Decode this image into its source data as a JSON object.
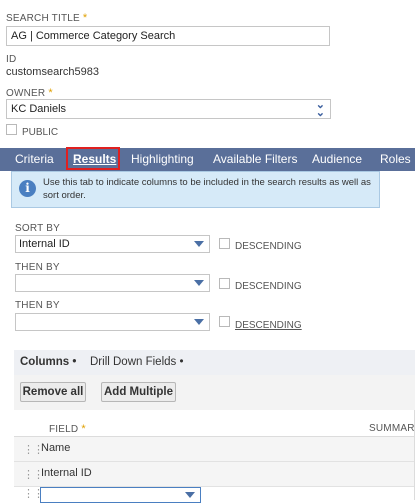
{
  "form": {
    "search_title_label": "SEARCH TITLE",
    "search_title_value": "AG | Commerce Category Search",
    "id_label": "ID",
    "id_value": "customsearch5983",
    "owner_label": "OWNER",
    "owner_value": "KC Daniels",
    "public_label": "PUBLIC",
    "required_mark": "*"
  },
  "tabs": [
    {
      "label": "Criteria"
    },
    {
      "label": "Results"
    },
    {
      "label": "Highlighting"
    },
    {
      "label": "Available Filters"
    },
    {
      "label": "Audience"
    },
    {
      "label": "Roles"
    }
  ],
  "active_tab": "Results",
  "info": {
    "icon": "info-icon",
    "text": "Use this tab to indicate columns to be included in the search results as well as sort order."
  },
  "sort": {
    "sort_by_label": "SORT BY",
    "sort_by_value": "Internal ID",
    "then_by_label_1": "THEN BY",
    "then_by_value_1": "",
    "then_by_label_2": "THEN BY",
    "then_by_value_2": "",
    "descending_label": "DESCENDING"
  },
  "subtabs": [
    {
      "label": "Columns •"
    },
    {
      "label": "Drill Down Fields •"
    }
  ],
  "buttons": {
    "remove_all": "Remove all",
    "add_multiple": "Add Multiple"
  },
  "grid": {
    "field_header": "FIELD",
    "summary_header": "SUMMARY",
    "rows": [
      {
        "field": "Name"
      },
      {
        "field": "Internal ID"
      }
    ],
    "new_row_value": ""
  },
  "colors": {
    "tab_bar": "#5a6f99",
    "highlight_outline": "#e02020",
    "info_bg": "#d6eaf8",
    "required": "#e0a000"
  }
}
